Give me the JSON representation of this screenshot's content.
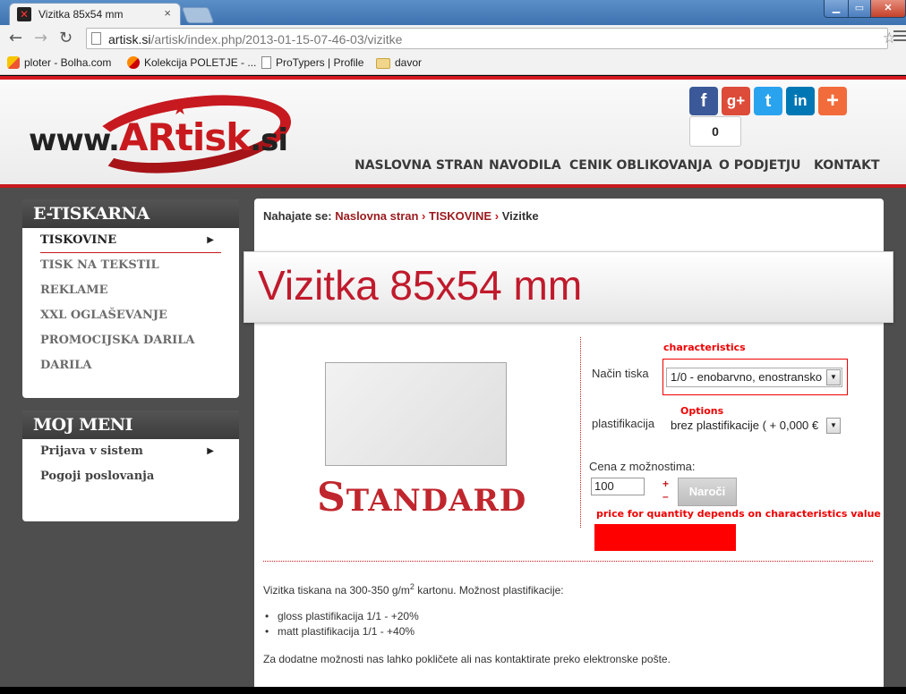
{
  "browser": {
    "tab_title": "Vizitka 85x54 mm",
    "tab_close": "×",
    "url_domain": "artisk.si",
    "url_path": "/artisk/index.php/2013-01-15-07-46-03/vizitke",
    "bookmarks": [
      {
        "label": "ploter - Bolha.com",
        "icon": "bolha-icon"
      },
      {
        "label": "Kolekcija POLETJE - ...",
        "icon": "kolekcija-icon"
      },
      {
        "label": "ProTypers | Profile",
        "icon": "page-icon"
      },
      {
        "label": "davor",
        "icon": "folder-icon"
      }
    ]
  },
  "header": {
    "logo": {
      "prefix": "www.",
      "brand": "ARtisk",
      "suffix": ".si"
    },
    "share_count": "0",
    "nav": [
      "NASLOVNA STRAN",
      "NAVODILA",
      "CENIK OBLIKOVANJA",
      "O PODJETJU",
      "KONTAKT"
    ],
    "social": [
      {
        "name": "facebook",
        "glyph": "f",
        "color": "#3b5998"
      },
      {
        "name": "google-plus",
        "glyph": "g+",
        "color": "#dd4b39"
      },
      {
        "name": "twitter",
        "glyph": "t",
        "color": "#2aa3ef"
      },
      {
        "name": "linkedin",
        "glyph": "in",
        "color": "#0077b5"
      },
      {
        "name": "addthis",
        "glyph": "+",
        "color": "#f26b3a"
      }
    ]
  },
  "sidebar": {
    "box1": {
      "title": "E-TISKARNA",
      "items": [
        "TISKOVINE",
        "TISK NA TEKSTIL",
        "REKLAME",
        "XXL OGLAŠEVANJE",
        "PROMOCIJSKA DARILA",
        "DARILA"
      ]
    },
    "box2": {
      "title": "MOJ MENI",
      "items": [
        "Prijava v sistem",
        "Pogoji poslovanja"
      ]
    }
  },
  "breadcrumb": {
    "prefix": "Nahajate se:",
    "items": [
      "Naslovna stran",
      "TISKOVINE",
      "Vizitke"
    ]
  },
  "product": {
    "title": "Vizitka 85x54 mm",
    "image_text": {
      "first": "S",
      "rest": "TANDARD"
    }
  },
  "form": {
    "annot_characteristics": "characteristics",
    "annot_options": "Options",
    "annot_price": "price for quantity depends on characteristics value",
    "print_label": "Način tiska",
    "print_value": "1/0 - enobarvno, enostransko",
    "lam_label": "plastifikacija",
    "lam_value": "brez plastifikacije ( + 0,000 €",
    "price_label": "Cena z možnostima:",
    "quantity": "100",
    "plus": "+",
    "minus": "–",
    "order_button": "Naroči"
  },
  "description": {
    "intro_before": "Vizitka tiskana na 300-350 g/m",
    "intro_sup": "2",
    "intro_after": " kartonu. Možnost plastifikacije:",
    "bullets": [
      "gloss plastifikacija 1/1 - +20%",
      "matt plastifikacija 1/1 - +40%"
    ],
    "footer": "Za dodatne možnosti nas lahko pokličete ali nas kontaktirate preko elektronske pošte."
  },
  "colors": {
    "accent": "#c81a1e",
    "title": "#c01a2c",
    "price_box": "#ff0000"
  }
}
